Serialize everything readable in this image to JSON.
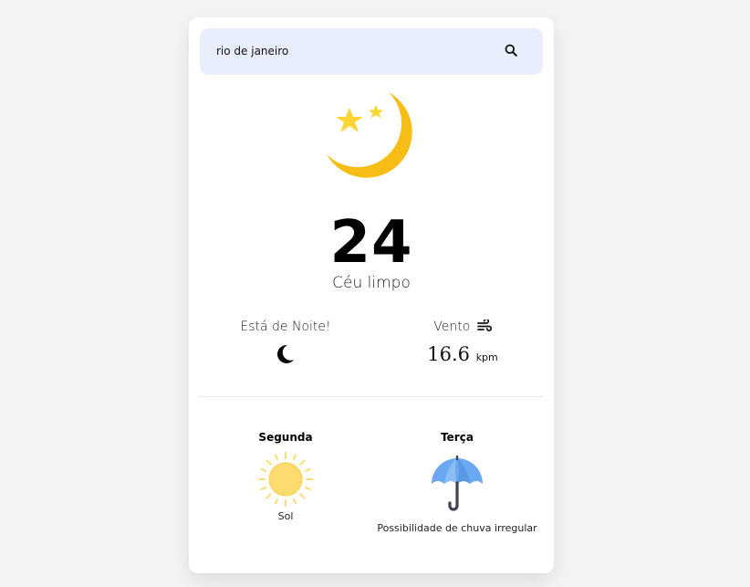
{
  "search": {
    "value": "rio de janeiro",
    "icon": "search-icon"
  },
  "current": {
    "icon": "crescent-moon-stars-icon",
    "temperature": "24",
    "description": "Céu limpo"
  },
  "info": {
    "night_label": "Está de Noite!",
    "night_icon": "moon-icon",
    "wind_label": "Vento",
    "wind_icon": "wind-icon",
    "wind_value": "16.6",
    "wind_unit": "kpm"
  },
  "forecast": [
    {
      "day": "Segunda",
      "icon": "sun-icon",
      "text": "Sol"
    },
    {
      "day": "Terça",
      "icon": "umbrella-icon",
      "text": "Possibilidade de chuva irregular"
    }
  ],
  "colors": {
    "search_bg": "#e8eefb",
    "moon": "#fcd535",
    "sun": "#fedb6e",
    "umbrella": "#6aa8f2"
  }
}
